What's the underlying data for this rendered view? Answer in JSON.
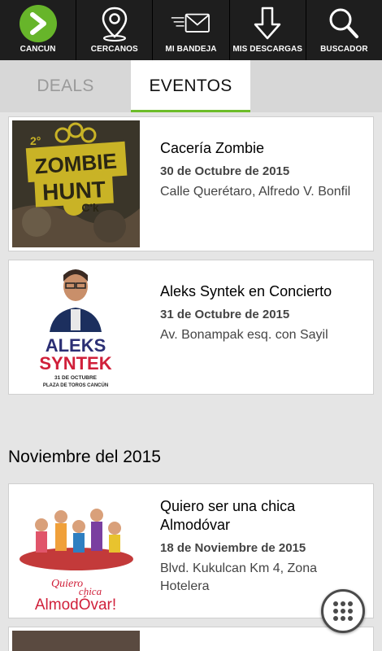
{
  "nav": [
    {
      "label": "CANCUN",
      "icon": "location-chevron-icon"
    },
    {
      "label": "CERCANOS",
      "icon": "map-pin-icon"
    },
    {
      "label": "MI BANDEJA",
      "icon": "envelope-icon"
    },
    {
      "label": "MIS DESCARGAS",
      "icon": "download-arrow-icon"
    },
    {
      "label": "BUSCADOR",
      "icon": "search-icon"
    }
  ],
  "tabs": {
    "deals": "DEALS",
    "eventos": "EVENTOS"
  },
  "colors": {
    "accent": "#6dbd2a",
    "topbar": "#1e1e1e",
    "background": "#e5e5e5"
  },
  "events": [
    {
      "title": "Cacería Zombie",
      "date": "30 de Octubre de 2015",
      "address": "Calle Querétaro, Alfredo V. Bonfil",
      "poster": {
        "line1": "ZOMBIE",
        "line2": "HUNT",
        "badge": "2°",
        "mark": "C'k"
      }
    },
    {
      "title": "Aleks Syntek en Concierto",
      "date": "31 de Octubre de 2015",
      "address": "Av. Bonampak esq. con Sayil",
      "poster": {
        "line1": "ALEKS",
        "line2": "SYNTEK",
        "line3": "31 DE OCTUBRE",
        "line4": "PLAZA DE TOROS CANCÚN"
      }
    },
    {
      "title": "Quiero ser una chica Almodóvar",
      "date": "18 de Noviembre de 2015",
      "address": "Blvd. Kukulcan Km 4, Zona Hotelera",
      "poster": {
        "line1": "Quiero",
        "line2": "chica",
        "line3": "AlmodÓvar!"
      }
    }
  ],
  "section": {
    "november": "Noviembre del 2015"
  }
}
